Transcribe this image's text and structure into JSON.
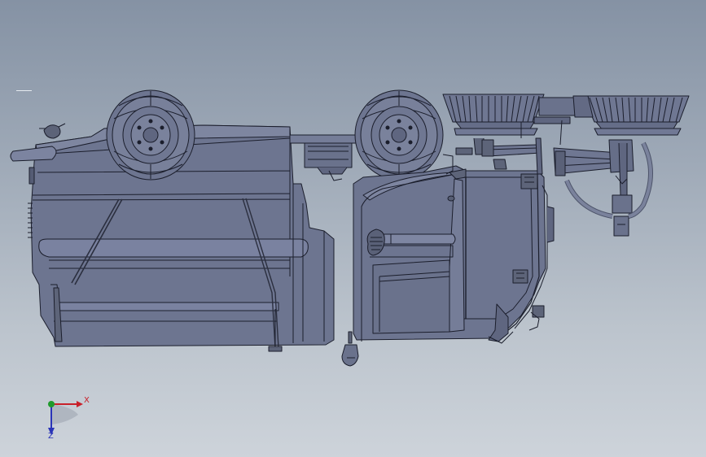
{
  "viewport": {
    "background_top": "#8592a4",
    "background_bottom": "#cdd3da"
  },
  "model": {
    "body_fill": "#6d7590",
    "edge_color": "#1b1e2c",
    "highlight": "#8a92ab",
    "shadow": "#565d76"
  },
  "triad": {
    "x_label": "X",
    "z_label": "Z",
    "x_color": "#c8202a",
    "y_color": "#1f9a2c",
    "z_color": "#2a34b8"
  }
}
